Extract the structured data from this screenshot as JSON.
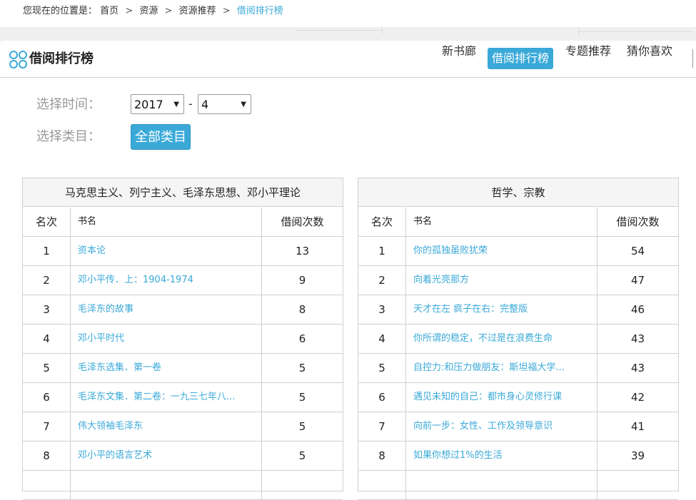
{
  "breadcrumb": {
    "prefix": "您现在的位置是：",
    "items": [
      "首页",
      "资源",
      "资源推荐"
    ],
    "current": "借阅排行榜",
    "separator": ">"
  },
  "header": {
    "title": "借阅排行榜",
    "logo_icon": "circles-logo-icon"
  },
  "nav": {
    "items": [
      {
        "label": "新书廊",
        "active": false
      },
      {
        "label": "借阅排行榜",
        "active": true
      },
      {
        "label": "专题推荐",
        "active": false
      },
      {
        "label": "猜你喜欢",
        "active": false
      }
    ]
  },
  "filters": {
    "time_label": "选择时间：",
    "year": "2017",
    "month": "4",
    "dash": "-",
    "category_label": "选择类目：",
    "category_button": "全部类目"
  },
  "columns": {
    "rank": "名次",
    "name": "书名",
    "count": "借阅次数"
  },
  "tables": [
    {
      "title": "马克思主义、列宁主义、毛泽东思想、邓小平理论",
      "rows": [
        {
          "rank": "1",
          "name": "资本论",
          "count": "13"
        },
        {
          "rank": "2",
          "name": "邓小平传．上：1904-1974",
          "count": "9"
        },
        {
          "rank": "3",
          "name": "毛泽东的故事",
          "count": "8"
        },
        {
          "rank": "4",
          "name": "邓小平时代",
          "count": "6"
        },
        {
          "rank": "5",
          "name": "毛泽东选集．第一卷",
          "count": "5"
        },
        {
          "rank": "6",
          "name": "毛泽东文集．第二卷：一九三七年八...",
          "count": "5"
        },
        {
          "rank": "7",
          "name": "伟大领袖毛泽东",
          "count": "5"
        },
        {
          "rank": "8",
          "name": "邓小平的语言艺术",
          "count": "5"
        }
      ]
    },
    {
      "title": "哲学、宗教",
      "rows": [
        {
          "rank": "1",
          "name": "你的孤独虽败犹荣",
          "count": "54"
        },
        {
          "rank": "2",
          "name": "向着光亮那方",
          "count": "47"
        },
        {
          "rank": "3",
          "name": "天才在左 疯子在右：完整版",
          "count": "46"
        },
        {
          "rank": "4",
          "name": "你所谓的稳定，不过是在浪费生命",
          "count": "43"
        },
        {
          "rank": "5",
          "name": "自控力:和压力做朋友：斯坦福大学...",
          "count": "43"
        },
        {
          "rank": "6",
          "name": "遇见未知的自己：都市身心灵修行课",
          "count": "42"
        },
        {
          "rank": "7",
          "name": "向前一步：女性、工作及领导意识",
          "count": "41"
        },
        {
          "rank": "8",
          "name": "如果你想过1%的生活",
          "count": "39"
        }
      ]
    }
  ]
}
